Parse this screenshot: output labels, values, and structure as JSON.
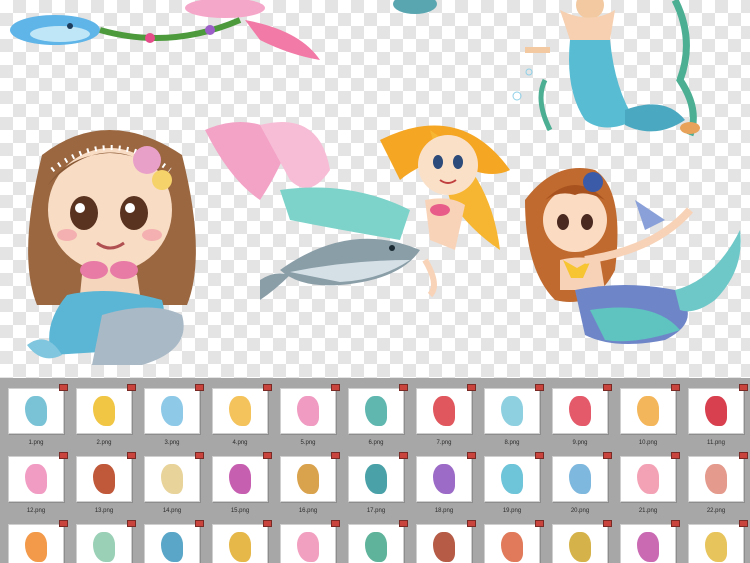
{
  "gallery": {
    "files": [
      {
        "label": "1.png",
        "color": "#7ac3d6"
      },
      {
        "label": "2.png",
        "color": "#f0c644"
      },
      {
        "label": "3.png",
        "color": "#8ec9e8"
      },
      {
        "label": "4.png",
        "color": "#f4c35c"
      },
      {
        "label": "5.png",
        "color": "#f09bc1"
      },
      {
        "label": "6.png",
        "color": "#5fb7b0"
      },
      {
        "label": "7.png",
        "color": "#e0575d"
      },
      {
        "label": "8.png",
        "color": "#8fd0e0"
      },
      {
        "label": "9.png",
        "color": "#e45a6b"
      },
      {
        "label": "10.png",
        "color": "#f4b65a"
      },
      {
        "label": "11.png",
        "color": "#d8404f"
      },
      {
        "label": "12.png",
        "color": "#f19cc3"
      },
      {
        "label": "13.png",
        "color": "#c0583a"
      },
      {
        "label": "14.png",
        "color": "#e8d39a"
      },
      {
        "label": "15.png",
        "color": "#c75fb0"
      },
      {
        "label": "16.png",
        "color": "#d9a24d"
      },
      {
        "label": "17.png",
        "color": "#4aa2a8"
      },
      {
        "label": "18.png",
        "color": "#9b6bc7"
      },
      {
        "label": "19.png",
        "color": "#6ec4d8"
      },
      {
        "label": "20.png",
        "color": "#7fb8de"
      },
      {
        "label": "21.png",
        "color": "#f3a2b6"
      },
      {
        "label": "22.png",
        "color": "#e49a8c"
      },
      {
        "label": "",
        "color": "#f29a4a"
      },
      {
        "label": "",
        "color": "#9ad0b6"
      },
      {
        "label": "",
        "color": "#5aa6c8"
      },
      {
        "label": "",
        "color": "#e6b84a"
      },
      {
        "label": "",
        "color": "#f2a0c0"
      },
      {
        "label": "",
        "color": "#5fb39a"
      },
      {
        "label": "",
        "color": "#b55b46"
      },
      {
        "label": "",
        "color": "#e07a5a"
      },
      {
        "label": "",
        "color": "#d6b34a"
      },
      {
        "label": "",
        "color": "#c96ab2"
      },
      {
        "label": "",
        "color": "#e8c45c"
      }
    ]
  }
}
